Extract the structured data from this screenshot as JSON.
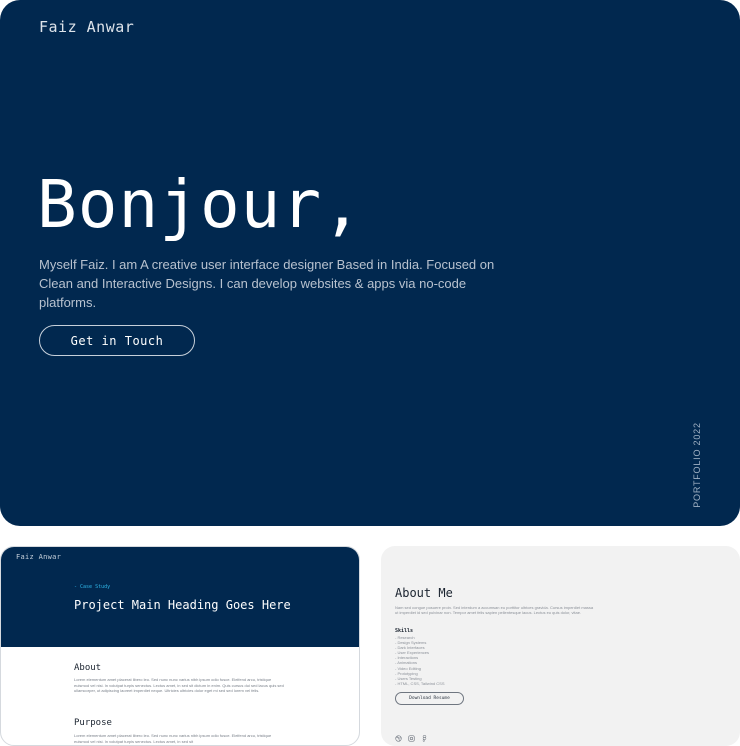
{
  "hero": {
    "brand": "Faiz Anwar",
    "greeting": "Bonjour,",
    "intro": "Myself Faiz. I am A creative user interface designer Based in India. Focused on Clean and Interactive Designs. I can develop websites & apps via no-code platforms.",
    "cta_label": "Get in Touch",
    "vertical_label": "PORTFOLIO 2022"
  },
  "case_study": {
    "brand": "Faiz Anwar",
    "kicker": "- Case Study",
    "heading": "Project Main Heading Goes Here",
    "sections": [
      {
        "title": "About",
        "body": "Lorem elementum amet placerat libero leo. Sed nunc nunc varius nibh ipsum odio fusce. Eleifend arcu, tristique euismod vel nisi. In volutpat turpis senectus. Lectus amet, in sed sit dictum in enim. Quis cursus dui sed lacus quis sed ullamcorper, ut adipiscing laoreet imperdiet neque. Ultricies ultricies dolor eget mi sed sed lorem vel felis."
      },
      {
        "title": "Purpose",
        "body": "Lorem elementum amet placerat libero leo. Sed nunc nunc varius nibh ipsum odio fusce. Eleifend arcu, tristique euismod vel nisi. In volutpat turpis senectus. Lectus amet, in sed sit"
      }
    ]
  },
  "about": {
    "title": "About Me",
    "description": "Nam sed congue posuere proin. Sed interdum a accumsan eu porttitor ultrices gravida. Cursus imperdiet massa ut imperdiet id sed pulvinar non. Tempor amet felis sapien pellentesque lacus. Lectus eu quis dolor, vitae.",
    "skills_title": "Skills",
    "skills": [
      "- Research",
      "- Design Systems",
      "- Dark Interfaces",
      "- User Experiences",
      "- Interactions",
      "- Animations",
      "- Video Editing",
      "- Prototyping",
      "- Users Testing",
      "- HTML, CSS, Tailwind CSS"
    ],
    "resume_label": "Download Resume",
    "socials": [
      "dribbble-icon",
      "instagram-icon",
      "figma-icon"
    ]
  },
  "colors": {
    "navy": "#01284f",
    "accent": "#2fb6e8",
    "card_gray": "#f2f2f2"
  }
}
